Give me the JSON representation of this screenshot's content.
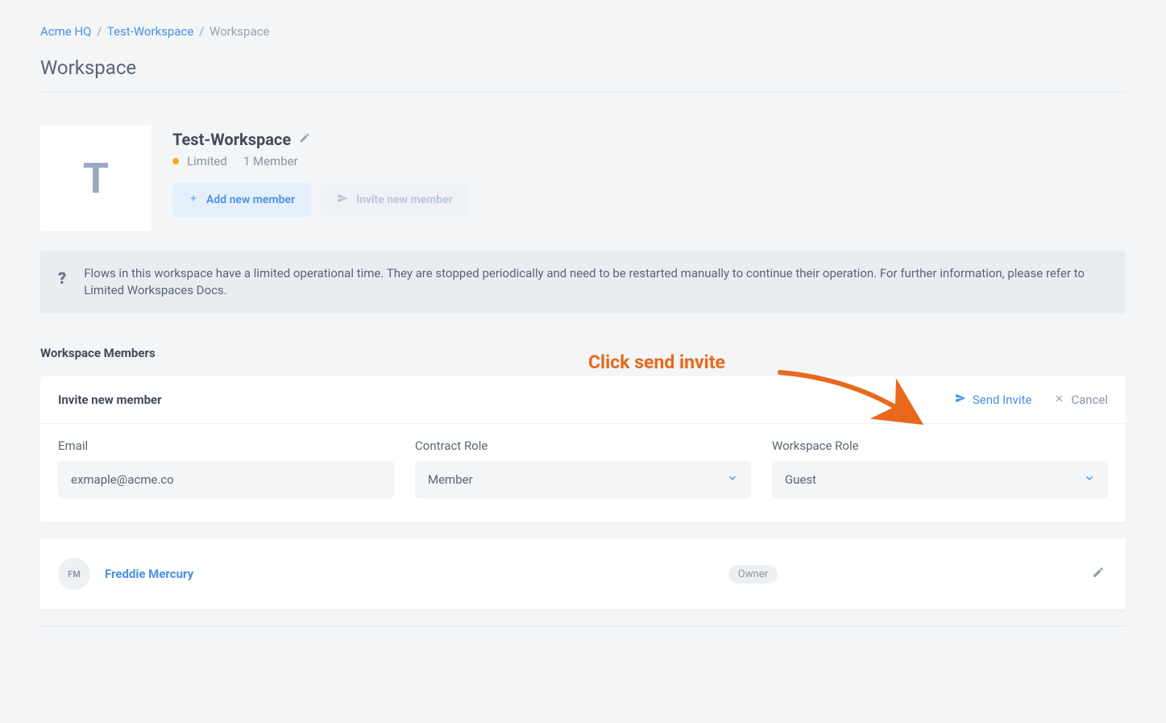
{
  "breadcrumb": {
    "org": "Acme HQ",
    "workspace": "Test-Workspace",
    "current": "Workspace"
  },
  "page_title": "Workspace",
  "workspace": {
    "avatar_letter": "T",
    "name": "Test-Workspace",
    "status": "Limited",
    "member_count": "1 Member",
    "add_member_label": "Add new member",
    "invite_member_label": "Invite new member"
  },
  "info_banner": {
    "text": "Flows in this workspace have a limited operational time. They are stopped periodically and need to be restarted manually to continue their operation. For further information, please refer to Limited Workspaces Docs."
  },
  "members_heading": "Workspace Members",
  "invite": {
    "title": "Invite new member",
    "send_label": "Send Invite",
    "cancel_label": "Cancel",
    "email_label": "Email",
    "email_value": "exmaple@acme.co",
    "contract_role_label": "Contract Role",
    "contract_role_value": "Member",
    "workspace_role_label": "Workspace Role",
    "workspace_role_value": "Guest"
  },
  "member": {
    "initials": "FM",
    "name": "Freddie Mercury",
    "role": "Owner"
  },
  "annotation": {
    "text": "Click send invite"
  }
}
